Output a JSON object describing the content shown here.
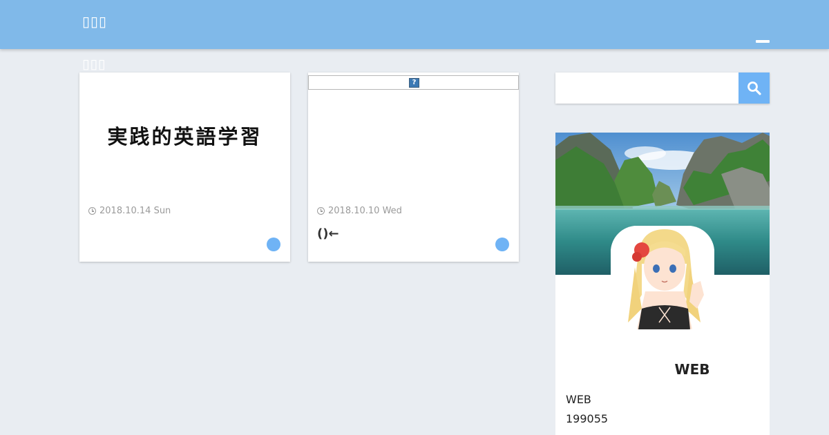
{
  "header": {
    "site_title": "▯▯▯",
    "sub_title": "▯▯▯"
  },
  "posts": [
    {
      "thumbnail_text": "実践的英語学習",
      "date": "2018.10.14 Sun",
      "title": ""
    },
    {
      "thumbnail_text": "",
      "date": "2018.10.10 Wed",
      "title": "()←"
    }
  ],
  "search": {
    "placeholder": ""
  },
  "profile": {
    "name": "WEB",
    "line1": "WEB",
    "line2": "199055"
  },
  "colors": {
    "header": "#80b9e9",
    "accent": "#6fb3f5",
    "background": "#e9edf2"
  },
  "icons": {
    "menu": "hamburger-icon",
    "search": "search-icon",
    "clock": "clock-icon",
    "broken_image": "broken-image-icon"
  }
}
